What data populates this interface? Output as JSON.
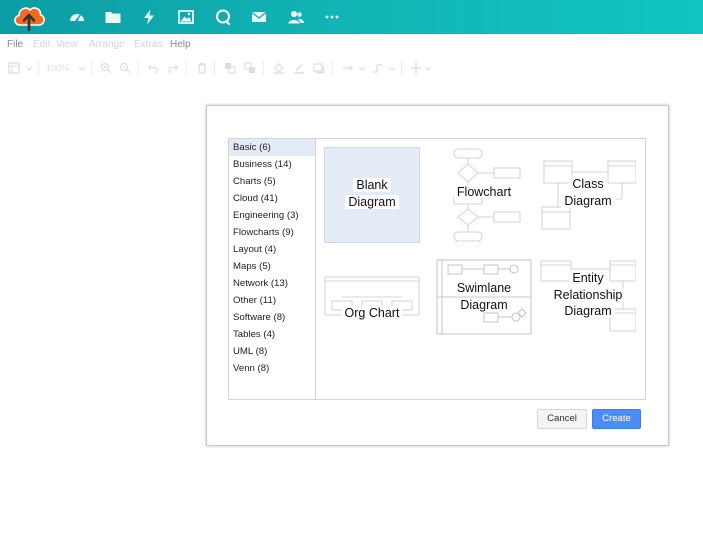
{
  "colors": {
    "topbar_start": "#0c9da5",
    "topbar_end": "#10c4c2",
    "logo_orange": "#f46a1f",
    "selection_bg": "#e3ebf6",
    "primary_button": "#4c8cf4"
  },
  "topbar": {
    "icons": [
      "cloud-upload-logo",
      "dashboard-gauge-icon",
      "folder-icon",
      "lightning-icon",
      "image-icon",
      "chat-bubble-icon",
      "envelope-icon",
      "users-icon",
      "more-dots-icon"
    ]
  },
  "menubar": {
    "items": [
      "File",
      "Edit",
      "View",
      "Arrange",
      "Extras",
      "Help"
    ]
  },
  "toolbar": {
    "zoom": "100%"
  },
  "dialog": {
    "categories": [
      {
        "label": "Basic (6)",
        "selected": true
      },
      {
        "label": "Business (14)"
      },
      {
        "label": "Charts (5)"
      },
      {
        "label": "Cloud (41)"
      },
      {
        "label": "Engineering (3)"
      },
      {
        "label": "Flowcharts (9)"
      },
      {
        "label": "Layout (4)"
      },
      {
        "label": "Maps (5)"
      },
      {
        "label": "Network (13)"
      },
      {
        "label": "Other (11)"
      },
      {
        "label": "Software (8)"
      },
      {
        "label": "Tables (4)"
      },
      {
        "label": "UML (8)"
      },
      {
        "label": "Venn (8)"
      }
    ],
    "templates": [
      {
        "label_lines": [
          "Blank",
          "Diagram"
        ],
        "selected": true
      },
      {
        "label_lines": [
          "Flowchart"
        ]
      },
      {
        "label_lines": [
          "Class",
          "Diagram"
        ]
      },
      {
        "label_lines": [
          "Org Chart"
        ]
      },
      {
        "label_lines": [
          "Swimlane",
          "Diagram"
        ]
      },
      {
        "label_lines": [
          "Entity",
          "Relationship",
          "Diagram"
        ]
      }
    ],
    "cancel_label": "Cancel",
    "create_label": "Create"
  }
}
